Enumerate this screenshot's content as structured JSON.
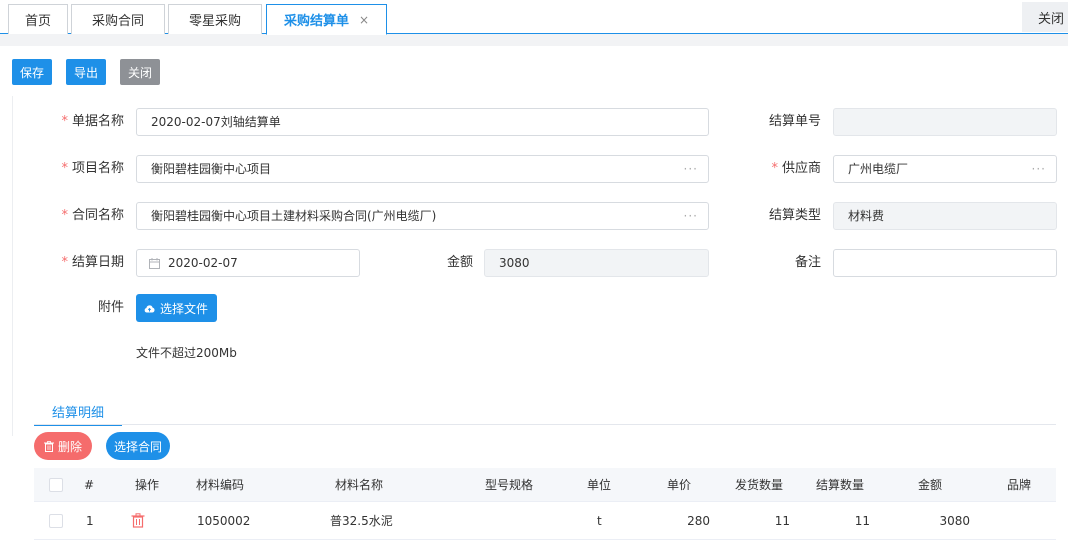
{
  "tabs": [
    {
      "label": "首页"
    },
    {
      "label": "采购合同"
    },
    {
      "label": "零星采购"
    },
    {
      "label": "采购结算单",
      "close": "×"
    }
  ],
  "close_all_label": "关闭",
  "toolbar": {
    "save": "保存",
    "export": "导出",
    "close": "关闭"
  },
  "form": {
    "doc_name_label": "单据名称",
    "doc_name_value": "2020-02-07刘轴结算单",
    "settle_no_label": "结算单号",
    "settle_no_value": "",
    "project_label": "项目名称",
    "project_value": "衡阳碧桂园衡中心项目",
    "supplier_label": "供应商",
    "supplier_value": "广州电缆厂",
    "contract_label": "合同名称",
    "contract_value": "衡阳碧桂园衡中心项目土建材料采购合同(广州电缆厂)",
    "settle_type_label": "结算类型",
    "settle_type_value": "材料费",
    "date_label": "结算日期",
    "date_value": "2020-02-07",
    "amount_label": "金额",
    "amount_value": "3080",
    "remark_label": "备注",
    "remark_value": "",
    "attachment_label": "附件",
    "upload_button": "选择文件",
    "upload_hint": "文件不超过200Mb",
    "required_mark": "*",
    "lookup_dots": "···"
  },
  "detail": {
    "tab_label": "结算明细",
    "delete_button": "删除",
    "select_contract_button": "选择合同",
    "columns": [
      "#",
      "操作",
      "材料编码",
      "材料名称",
      "型号规格",
      "单位",
      "单价",
      "发货数量",
      "结算数量",
      "金额",
      "品牌"
    ],
    "rows": [
      {
        "index": "1",
        "code": "1050002",
        "name": "普32.5水泥",
        "spec": "",
        "unit": "t",
        "price": "280",
        "ship_qty": "11",
        "settle_qty": "11",
        "amount": "3080",
        "brand": ""
      }
    ]
  },
  "colors": {
    "primary": "#1e90e8",
    "danger": "#f56c6c",
    "gray_button": "#8e9196"
  }
}
